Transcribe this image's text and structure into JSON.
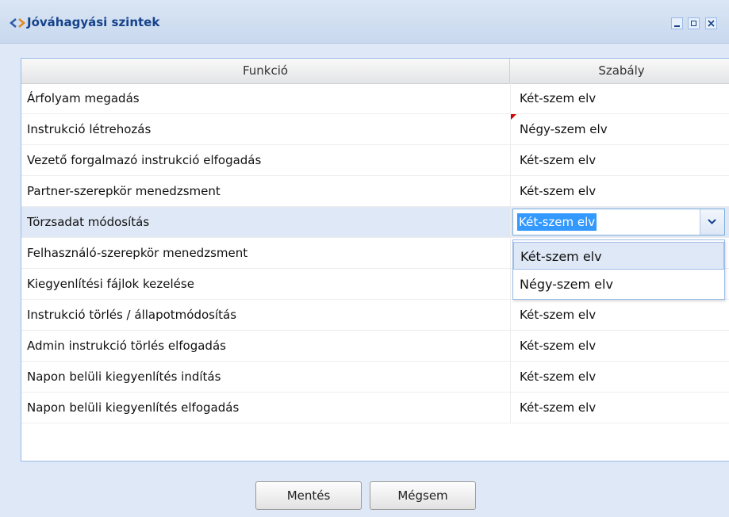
{
  "window": {
    "title": "Jóváhagyási szintek",
    "icon": "approval-levels-icon"
  },
  "grid": {
    "headers": {
      "function": "Funkció",
      "rule": "Szabály"
    },
    "rows": [
      {
        "function": "Árfolyam megadás",
        "rule": "Két-szem elv"
      },
      {
        "function": "Instrukció létrehozás",
        "rule": "Négy-szem elv",
        "dirty": true
      },
      {
        "function": "Vezető forgalmazó instrukció elfogadás",
        "rule": "Két-szem elv"
      },
      {
        "function": "Partner-szerepkör menedzsment",
        "rule": "Két-szem elv"
      },
      {
        "function": "Törzsadat módosítás",
        "rule": "Két-szem elv",
        "selected": true
      },
      {
        "function": "Felhasználó-szerepkör menedzsment",
        "rule": "Két-szem elv"
      },
      {
        "function": "Kiegyenlítési fájlok kezelése",
        "rule": "Két-szem elv"
      },
      {
        "function": "Instrukció törlés / állapotmódosítás",
        "rule": "Két-szem elv"
      },
      {
        "function": "Admin instrukció törlés elfogadás",
        "rule": "Két-szem elv"
      },
      {
        "function": "Napon belüli kiegyenlítés indítás",
        "rule": "Két-szem elv"
      },
      {
        "function": "Napon belüli kiegyenlítés elfogadás",
        "rule": "Két-szem elv"
      }
    ]
  },
  "editor": {
    "value": "Két-szem elv",
    "options": [
      "Két-szem elv",
      "Négy-szem elv"
    ]
  },
  "buttons": {
    "save": "Mentés",
    "cancel": "Mégsem"
  },
  "colors": {
    "title_text": "#15428b",
    "selected_row": "#dfe8f6",
    "selection_highlight": "#3399ff",
    "dirty_marker": "#d00000"
  }
}
